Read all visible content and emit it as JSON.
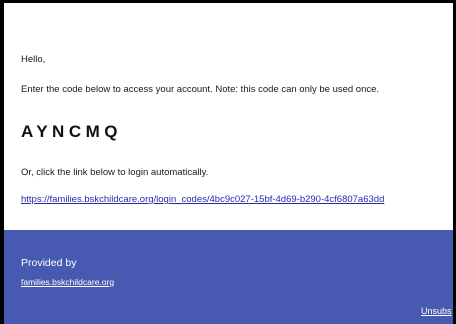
{
  "email": {
    "greeting": "Hello,",
    "instruction": "Enter the code below to access your account. Note: this code can only be used once.",
    "code": "AYNCMQ",
    "alt_text": "Or, click the link below to login automatically.",
    "login_link": "https://families.bskchildcare.org/login_codes/4bc9c027-15bf-4d69-b290-4cf6807a63dd"
  },
  "footer": {
    "provided_by": "Provided by",
    "site_link": "families.bskchildcare.org",
    "unsubscribe": "Unsubs"
  },
  "colors": {
    "footer_background": "#4759b1",
    "link": "#2a2aa8",
    "border": "#000000"
  }
}
